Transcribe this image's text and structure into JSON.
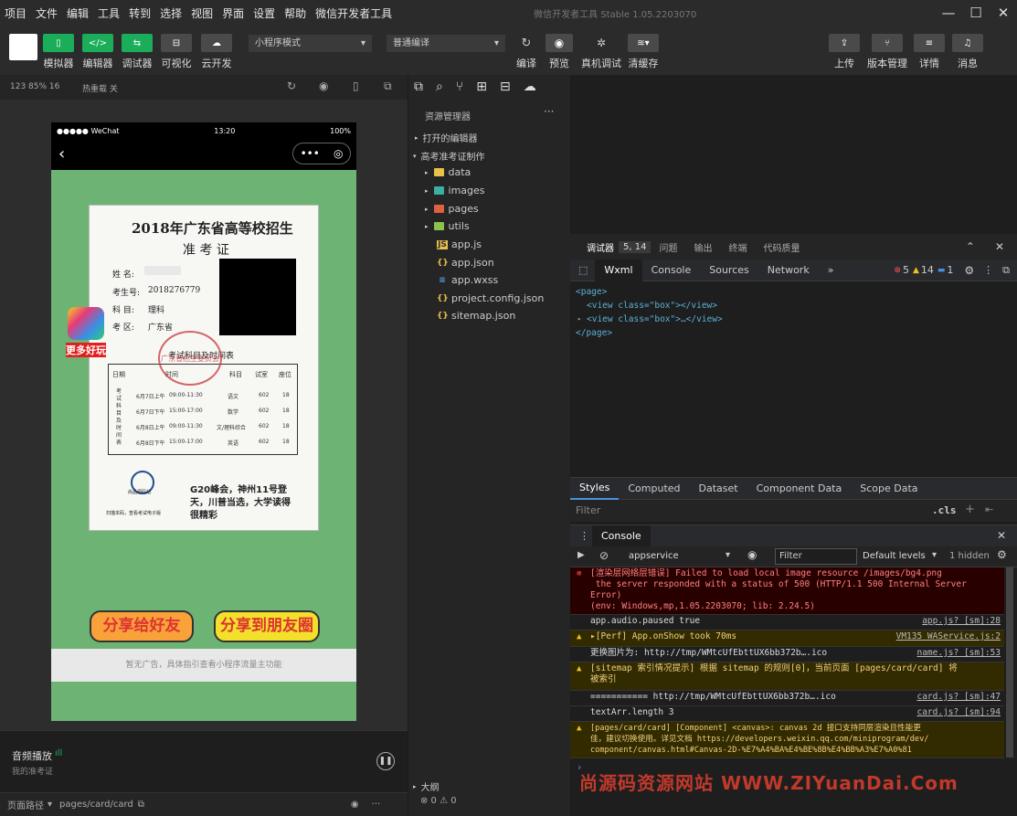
{
  "menu": [
    "项目",
    "文件",
    "编辑",
    "工具",
    "转到",
    "选择",
    "视图",
    "界面",
    "设置",
    "帮助",
    "微信开发者工具"
  ],
  "window_title": "微信开发者工具 Stable 1.05.2203070",
  "toolbar": {
    "buttons": [
      "模拟器",
      "编辑器",
      "调试器",
      "可视化",
      "云开发"
    ],
    "mode_select": "小程序模式",
    "compile_select": "普通编译",
    "actions": [
      "编译",
      "预览",
      "真机调试",
      "清缓存"
    ],
    "right": [
      "上传",
      "版本管理",
      "详情",
      "消息"
    ]
  },
  "sim": {
    "device": "123 85% 16",
    "hotreload": "热重载 关",
    "carrier": "●●●●● WeChat",
    "time": "13:20",
    "battery": "100%"
  },
  "card": {
    "title": "2018年广东省高等校招生",
    "subtitle": "准 考 证",
    "name_label": "姓  名:",
    "examno_label": "考生号:",
    "examno": "2018276779",
    "subject_label": "科  目:",
    "subject": "理科",
    "area_label": "考  区:",
    "area": "广东省",
    "schedule_title": "考试科目及时间表",
    "sched_headers": [
      "日期",
      "时间",
      "科目",
      "试室",
      "座位"
    ],
    "sched_side": "考试科目及时间表",
    "rows": [
      {
        "date": "6月7日上午",
        "time": "09:00-11:30",
        "subject": "语文",
        "room": "602",
        "seat": "18"
      },
      {
        "date": "6月7日下午",
        "time": "15:00-17:00",
        "subject": "数学",
        "room": "602",
        "seat": "18"
      },
      {
        "date": "6月8日上午",
        "time": "09:00-11:30",
        "subject": "文/理科综合",
        "room": "602",
        "seat": "18"
      },
      {
        "date": "6月8日下午",
        "time": "15:00-17:00",
        "subject": "英语",
        "room": "602",
        "seat": "18"
      }
    ],
    "news": "G20峰会，神州11号登天，川普当选，大学读得很精彩",
    "logo_text": "尚品源码站",
    "footer": "扫描本码，查看考试电子版",
    "stamp": "广东省招生委员会"
  },
  "side_icon_label": "更多好玩",
  "share": {
    "friend": "分享给好友",
    "moments": "分享到朋友圈"
  },
  "ad": "暂无广告，具体指引查看小程序流量主功能",
  "audio": {
    "title": "音频播放",
    "subtitle": "我的准考证"
  },
  "pagepath": {
    "label": "页面路径",
    "path": "pages/card/card"
  },
  "explorer": {
    "title": "资源管理器",
    "open_editors": "打开的编辑器",
    "project": "高考准考证制作",
    "folders": [
      "data",
      "images",
      "pages",
      "utils"
    ],
    "files": [
      "app.js",
      "app.json",
      "app.wxss",
      "project.config.json",
      "sitemap.json"
    ],
    "outline": "大纲",
    "status": "⊗ 0 ⚠ 0"
  },
  "debug": {
    "tabs": [
      "调试器",
      "5, 14",
      "问题",
      "输出",
      "终端",
      "代码质量"
    ],
    "devtabs": [
      "Wxml",
      "Console",
      "Sources",
      "Network"
    ],
    "counts": {
      "errors": "5",
      "warnings": "14",
      "info": "1"
    },
    "dom": [
      "<page>",
      "<view class=\"box\"></view>",
      "<view class=\"box\">…</view>",
      "</page>"
    ],
    "styletabs": [
      "Styles",
      "Computed",
      "Dataset",
      "Component Data",
      "Scope Data"
    ],
    "filter": "Filter",
    "cls": ".cls",
    "console_tab": "Console",
    "context": "appservice",
    "console_filter": "Filter",
    "levels": "Default levels",
    "hidden": "1 hidden"
  },
  "console": [
    {
      "type": "error",
      "text": "[渲染层网络层错误] Failed to load local image resource /images/bg4.png\n the server responded with a status of 500 (HTTP/1.1 500 Internal Server\nError)\n(env: Windows,mp,1.05.2203070; lib: 2.24.5)",
      "src": ""
    },
    {
      "type": "log",
      "text": "app.audio.paused true",
      "src": "app.js? [sm]:28"
    },
    {
      "type": "warn",
      "text": "▸[Perf] App.onShow took 70ms",
      "src": "VM135 WAService.js:2"
    },
    {
      "type": "log",
      "text": "更换图片为:  http://tmp/WMtcUfEbttUX6bb372b….ico",
      "src": "name.js? [sm]:53"
    },
    {
      "type": "warn",
      "text": "[sitemap 索引情况提示] 根据 sitemap 的规则[0]，当前页面 [pages/card/card] 将\n被索引",
      "src": ""
    },
    {
      "type": "log",
      "text": "=========== http://tmp/WMtcUfEbttUX6bb372b….ico",
      "src": "card.js? [sm]:47"
    },
    {
      "type": "log",
      "text": "textArr.length 3",
      "src": "card.js? [sm]:94"
    },
    {
      "type": "warn",
      "text": "[pages/card/card] [Component] <canvas>: canvas 2d 接口支持同层渲染且性能更\n佳，建议切换使用。详见文档 https://developers.weixin.qq.com/miniprogram/dev/\ncomponent/canvas.html#Canvas-2D-%E7%A4%BA%E4%BE%8B%E4%BB%A3%E7%A0%81",
      "src": ""
    }
  ],
  "watermark": "尚源码资源网站 WWW.ZIYuanDai.Com"
}
